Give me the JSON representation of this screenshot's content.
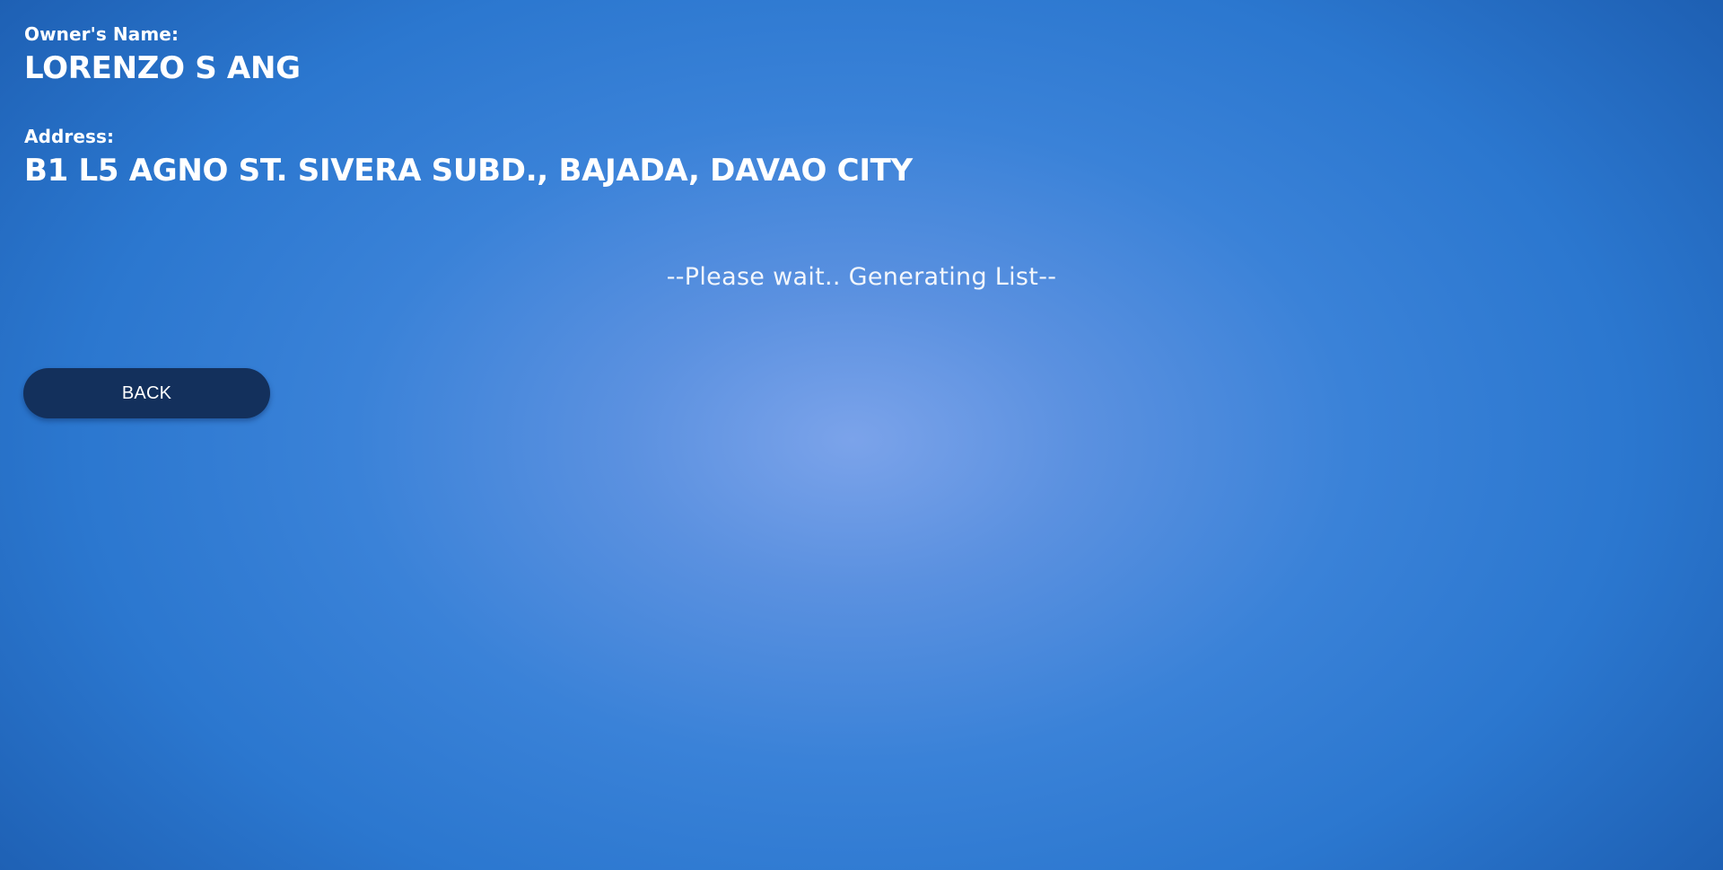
{
  "owner": {
    "label": "Owner's Name:",
    "name": "LORENZO S ANG"
  },
  "address": {
    "label": "Address:",
    "value": "B1 L5 AGNO ST. SIVERA SUBD., BAJADA, DAVAO CITY"
  },
  "status": {
    "message": "--Please wait.. Generating List--"
  },
  "actions": {
    "back_label": "BACK"
  }
}
